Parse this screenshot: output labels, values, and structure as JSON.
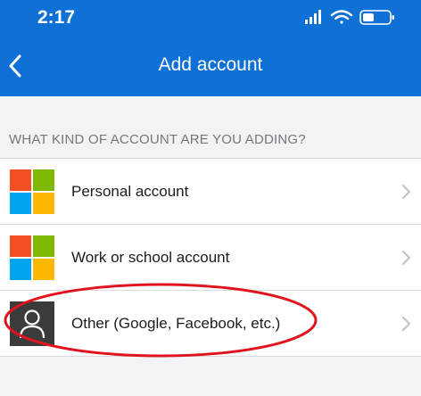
{
  "status_bar": {
    "time": "2:17"
  },
  "header": {
    "title": "Add account"
  },
  "section": {
    "label": "WHAT KIND OF ACCOUNT ARE YOU ADDING?"
  },
  "accounts": [
    {
      "label": "Personal account",
      "icon": "microsoft-logo-icon"
    },
    {
      "label": "Work or school account",
      "icon": "microsoft-logo-icon"
    },
    {
      "label": "Other (Google, Facebook, etc.)",
      "icon": "person-icon"
    }
  ],
  "colors": {
    "header_bg": "#0f71d6",
    "ms_red": "#f25022",
    "ms_green": "#7fba00",
    "ms_blue": "#00a4ef",
    "ms_yellow": "#ffb900",
    "annotation_red": "#e0141e"
  }
}
